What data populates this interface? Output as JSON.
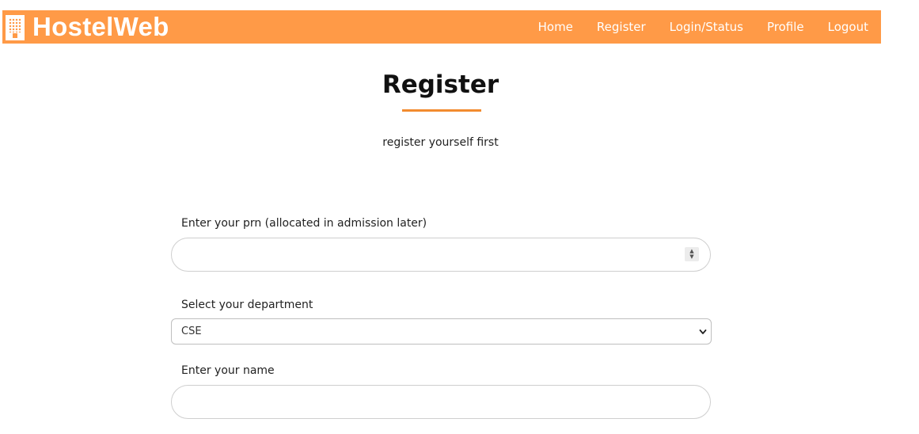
{
  "app": {
    "brand": "HostelWeb",
    "brand_icon": "hostel-building-icon",
    "accent_color": "#ff9a47"
  },
  "nav": {
    "items": [
      {
        "label": "Home"
      },
      {
        "label": "Register"
      },
      {
        "label": "Login/Status"
      },
      {
        "label": "Profile"
      },
      {
        "label": "Logout"
      }
    ]
  },
  "page": {
    "title": "Register",
    "subtitle": "register yourself first"
  },
  "form": {
    "prn": {
      "label": "Enter your prn (allocated in admission later)",
      "value": "",
      "placeholder": ""
    },
    "department": {
      "label": "Select your department",
      "selected": "CSE"
    },
    "name": {
      "label": "Enter your name",
      "value": "",
      "placeholder": ""
    }
  }
}
